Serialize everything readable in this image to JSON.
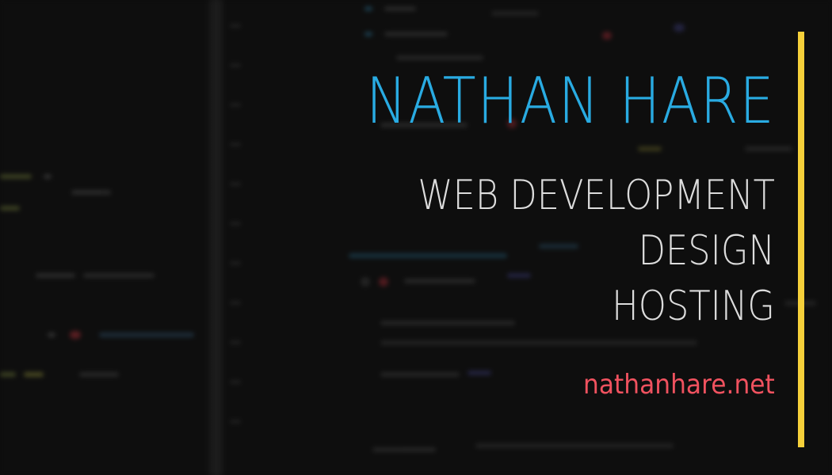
{
  "card": {
    "name": "NATHAN HARE",
    "services": [
      "WEB DEVELOPMENT",
      "DESIGN",
      "HOSTING"
    ],
    "website": "nathanhare.net"
  },
  "colors": {
    "background": "#0e0e0e",
    "name": "#29abe2",
    "services": "#dcdcdc",
    "website": "#f0525f",
    "accent_bar": "#f5d03a"
  }
}
